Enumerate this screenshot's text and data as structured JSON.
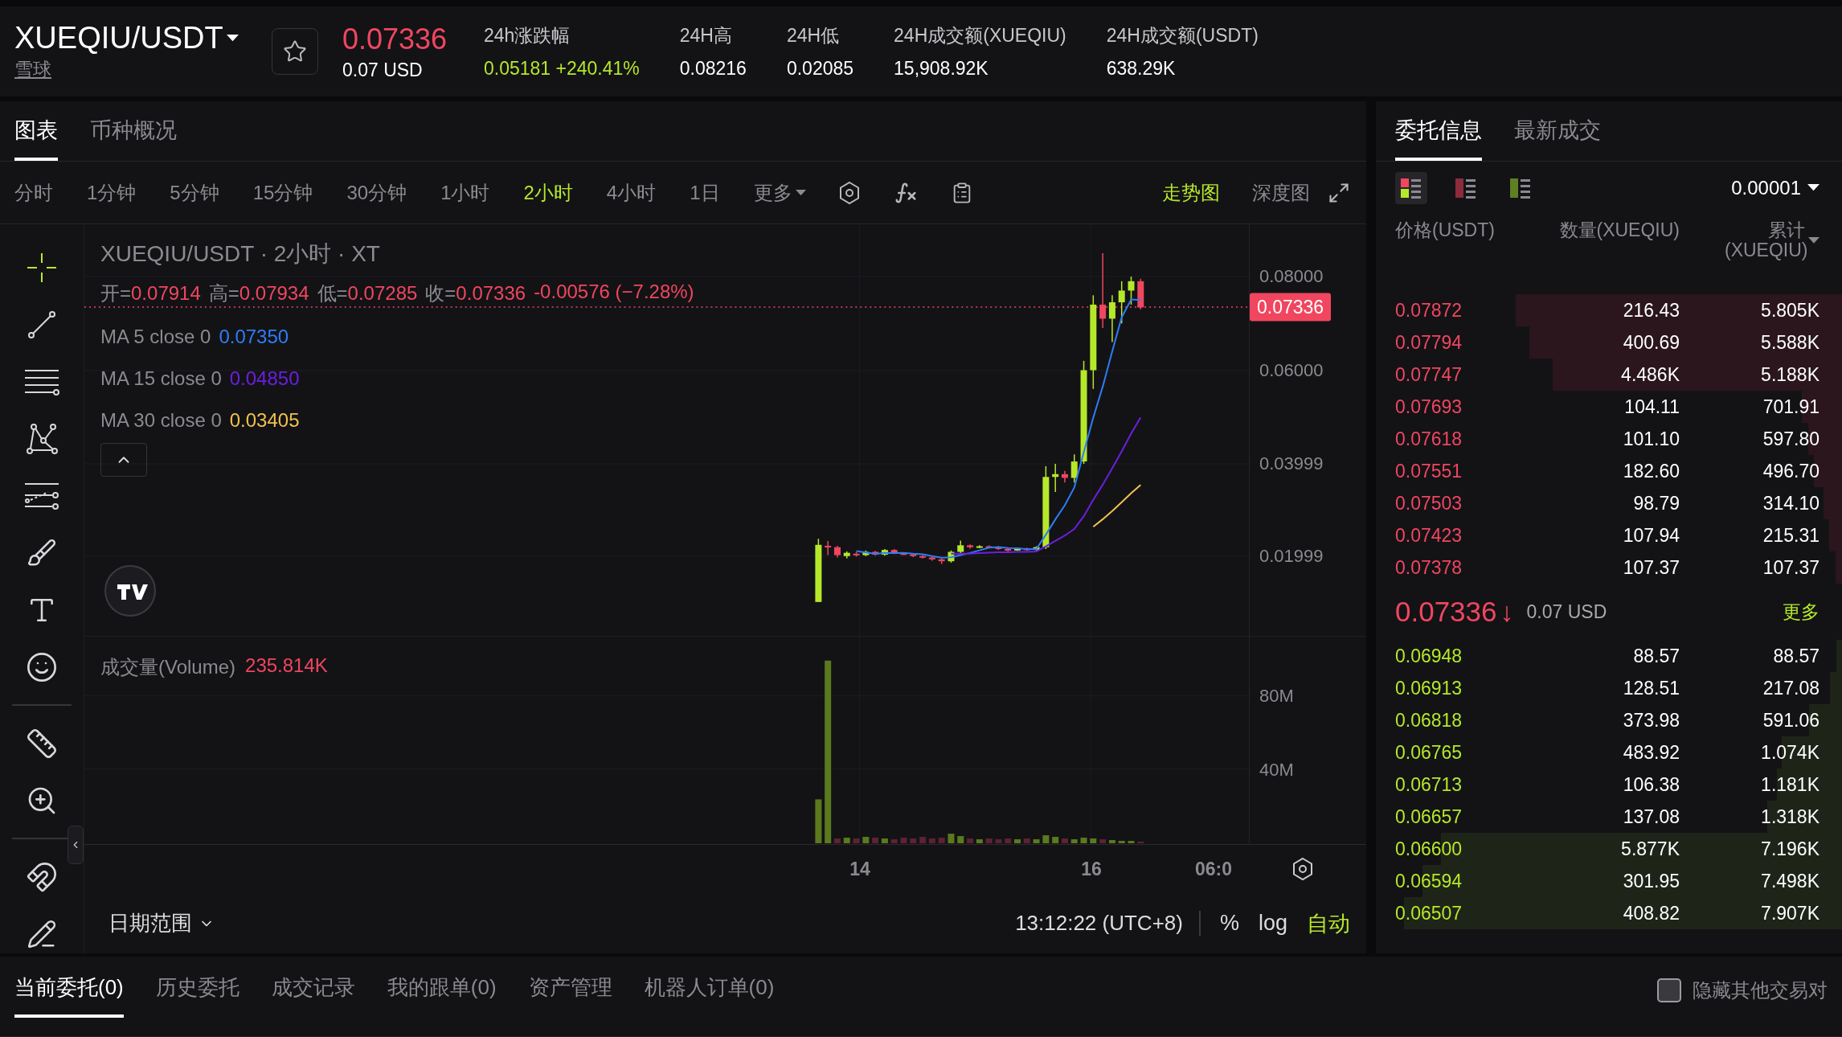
{
  "pair": {
    "symbol": "XUEQIU/USDT",
    "name": "雪球",
    "favorite": false
  },
  "ticker": {
    "price": "0.07336",
    "usd": "0.07 USD"
  },
  "stats": [
    {
      "label": "24h涨跌幅",
      "value": "0.05181 +240.41%",
      "color": "#b6e82a"
    },
    {
      "label": "24H高",
      "value": "0.08216",
      "color": "#ffffff"
    },
    {
      "label": "24H低",
      "value": "0.02085",
      "color": "#ffffff"
    },
    {
      "label": "24H成交额(XUEQIU)",
      "value": "15,908.92K",
      "color": "#ffffff"
    },
    {
      "label": "24H成交额(USDT)",
      "value": "638.29K",
      "color": "#ffffff"
    }
  ],
  "chart_tabs": [
    {
      "label": "图表",
      "selected": true
    },
    {
      "label": "币种概况",
      "selected": false
    }
  ],
  "intervals": [
    {
      "label": "分时",
      "selected": false
    },
    {
      "label": "1分钟",
      "selected": false
    },
    {
      "label": "5分钟",
      "selected": false
    },
    {
      "label": "15分钟",
      "selected": false
    },
    {
      "label": "30分钟",
      "selected": false
    },
    {
      "label": "1小时",
      "selected": false
    },
    {
      "label": "2小时",
      "selected": true
    },
    {
      "label": "4小时",
      "selected": false
    },
    {
      "label": "1日",
      "selected": false
    }
  ],
  "more_menu": "更多",
  "view_modes": [
    {
      "label": "走势图",
      "selected": true
    },
    {
      "label": "深度图",
      "selected": false
    }
  ],
  "drawing_tools": [
    {
      "kind": "crosshair"
    },
    {
      "kind": "trend-line"
    },
    {
      "kind": "horizontal-lines"
    },
    {
      "kind": "pattern"
    },
    {
      "kind": "fib"
    },
    {
      "kind": "brush"
    },
    {
      "kind": "text"
    },
    {
      "kind": "emoji"
    },
    {
      "kind": "divider"
    },
    {
      "kind": "ruler"
    },
    {
      "kind": "zoom"
    },
    {
      "kind": "divider"
    },
    {
      "kind": "magnet"
    },
    {
      "kind": "pencil-lock"
    }
  ],
  "chart": {
    "title": "XUEQIU/USDT · 2小时 · XT",
    "ohlc": [
      {
        "label": "开=",
        "value": "0.07914"
      },
      {
        "label": "高=",
        "value": "0.07934"
      },
      {
        "label": "低=",
        "value": "0.07285"
      },
      {
        "label": "收=",
        "value": "0.07336"
      }
    ],
    "change": "-0.00576 (−7.28%)",
    "ma": [
      {
        "label": "MA 5 close 0",
        "value": "0.07350",
        "color": "#2f7cf6"
      },
      {
        "label": "MA 15 close 0",
        "value": "0.04850",
        "color": "#6b1fe0"
      },
      {
        "label": "MA 30 close 0",
        "value": "0.03405",
        "color": "#f2c14e"
      }
    ],
    "price_axis": [
      "0.08000",
      "0.06000",
      "0.03999",
      "0.01999"
    ],
    "last_price": "0.07336",
    "volume": {
      "label": "成交量(Volume)",
      "value": "235.814K"
    },
    "volume_axis": [
      "80M",
      "40M"
    ],
    "time_axis": [
      "14",
      "16",
      "06:0"
    ]
  },
  "chart_footer": {
    "date_range": "日期范围",
    "time": "13:12:22 (UTC+8)",
    "options": [
      {
        "label": "%",
        "selected": false
      },
      {
        "label": "log",
        "selected": false
      },
      {
        "label": "自动",
        "selected": true
      }
    ]
  },
  "orderbook": {
    "tabs": [
      {
        "label": "委托信息",
        "selected": true
      },
      {
        "label": "最新成交",
        "selected": false
      }
    ],
    "modes": [
      {
        "kind": "both",
        "selected": true
      },
      {
        "kind": "asks",
        "selected": false
      },
      {
        "kind": "bids",
        "selected": false
      }
    ],
    "precision": "0.00001",
    "columns": [
      "价格(USDT)",
      "数量(XUEQIU)",
      "累计 (XUEQIU)"
    ],
    "asks": [
      {
        "price": "0.07872",
        "amount": "216.43",
        "total": "5.805K",
        "level": 0.7
      },
      {
        "price": "0.07794",
        "amount": "400.69",
        "total": "5.588K",
        "level": 0.67
      },
      {
        "price": "0.07747",
        "amount": "4.486K",
        "total": "5.188K",
        "level": 0.62
      },
      {
        "price": "0.07693",
        "amount": "104.11",
        "total": "701.91",
        "level": 0.086
      },
      {
        "price": "0.07618",
        "amount": "101.10",
        "total": "597.80",
        "level": 0.073
      },
      {
        "price": "0.07551",
        "amount": "182.60",
        "total": "496.70",
        "level": 0.06
      },
      {
        "price": "0.07503",
        "amount": "98.79",
        "total": "314.10",
        "level": 0.04
      },
      {
        "price": "0.07423",
        "amount": "107.94",
        "total": "215.31",
        "level": 0.027
      },
      {
        "price": "0.07378",
        "amount": "107.37",
        "total": "107.37",
        "level": 0.013
      }
    ],
    "last": {
      "price": "0.07336",
      "arrow": "↓",
      "usd": "0.07 USD",
      "more": "更多"
    },
    "bids": [
      {
        "price": "0.06948",
        "amount": "88.57",
        "total": "88.57",
        "level": 0.012
      },
      {
        "price": "0.06913",
        "amount": "128.51",
        "total": "217.08",
        "level": 0.026
      },
      {
        "price": "0.06818",
        "amount": "373.98",
        "total": "591.06",
        "level": 0.07
      },
      {
        "price": "0.06765",
        "amount": "483.92",
        "total": "1.074K",
        "level": 0.13
      },
      {
        "price": "0.06713",
        "amount": "106.38",
        "total": "1.181K",
        "level": 0.14
      },
      {
        "price": "0.06657",
        "amount": "137.08",
        "total": "1.318K",
        "level": 0.16
      },
      {
        "price": "0.06600",
        "amount": "5.877K",
        "total": "7.196K",
        "level": 0.86
      },
      {
        "price": "0.06594",
        "amount": "301.95",
        "total": "7.498K",
        "level": 0.9
      },
      {
        "price": "0.06507",
        "amount": "408.82",
        "total": "7.907K",
        "level": 0.94
      }
    ]
  },
  "orders": {
    "tabs": [
      {
        "label": "当前委托(0)",
        "selected": true
      },
      {
        "label": "历史委托",
        "selected": false
      },
      {
        "label": "成交记录",
        "selected": false
      },
      {
        "label": "我的跟单(0)",
        "selected": false
      },
      {
        "label": "资产管理",
        "selected": false
      },
      {
        "label": "机器人订单(0)",
        "selected": false
      }
    ],
    "hide_others": {
      "label": "隐藏其他交易对",
      "checked": false
    }
  }
}
